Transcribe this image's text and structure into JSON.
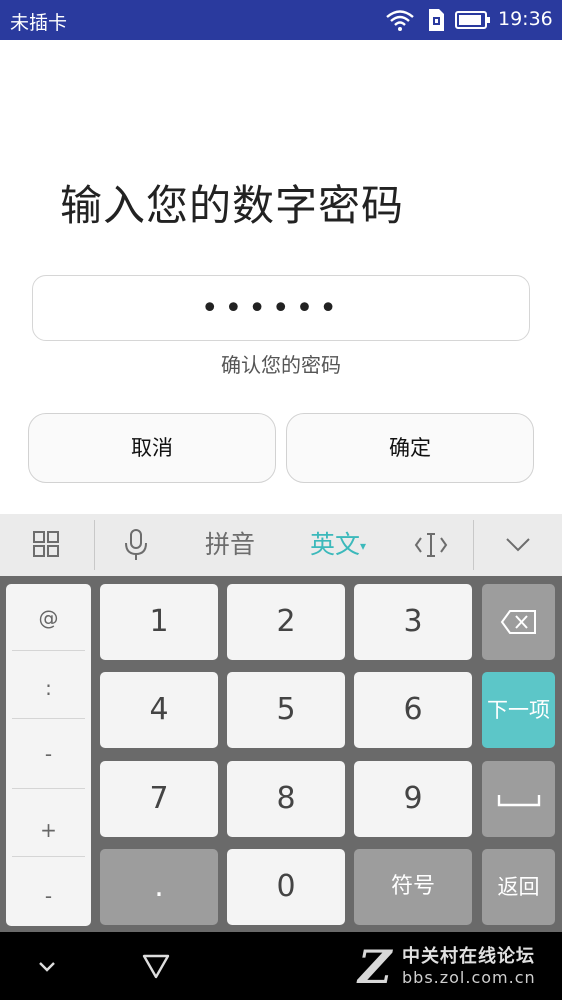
{
  "status_bar": {
    "carrier": "未插卡",
    "time": "19:36",
    "wifi_icon": "wifi-icon",
    "sim_icon": "sim-icon",
    "battery_icon": "battery-icon"
  },
  "main": {
    "title": "输入您的数字密码",
    "password_mask": "••••••",
    "hint": "确认您的密码",
    "cancel_label": "取消",
    "ok_label": "确定"
  },
  "keyboard_toolbar": {
    "grid_icon": "grid-icon",
    "mic_icon": "microphone-icon",
    "pinyin_label": "拼音",
    "english_label": "英文",
    "cursor_icon": "cursor-icon",
    "collapse_icon": "chevron-down-icon",
    "active_color": "#3cb9bb"
  },
  "keyboard": {
    "symbols": [
      "@",
      ":",
      "-",
      "+",
      "-"
    ],
    "digits": [
      "1",
      "2",
      "3",
      "4",
      "5",
      "6",
      "7",
      "8",
      "9",
      "0"
    ],
    "dot": ".",
    "symbols_label": "符号",
    "next_label": "下一项",
    "back_label": "返回",
    "next_color": "#5cc6c8"
  },
  "nav_bar": {
    "back_icon": "chevron-down-icon",
    "home_icon": "triangle-back-icon"
  },
  "watermark": {
    "logo": "Z",
    "title": "中关村在线论坛",
    "url": "bbs.zol.com.cn"
  }
}
